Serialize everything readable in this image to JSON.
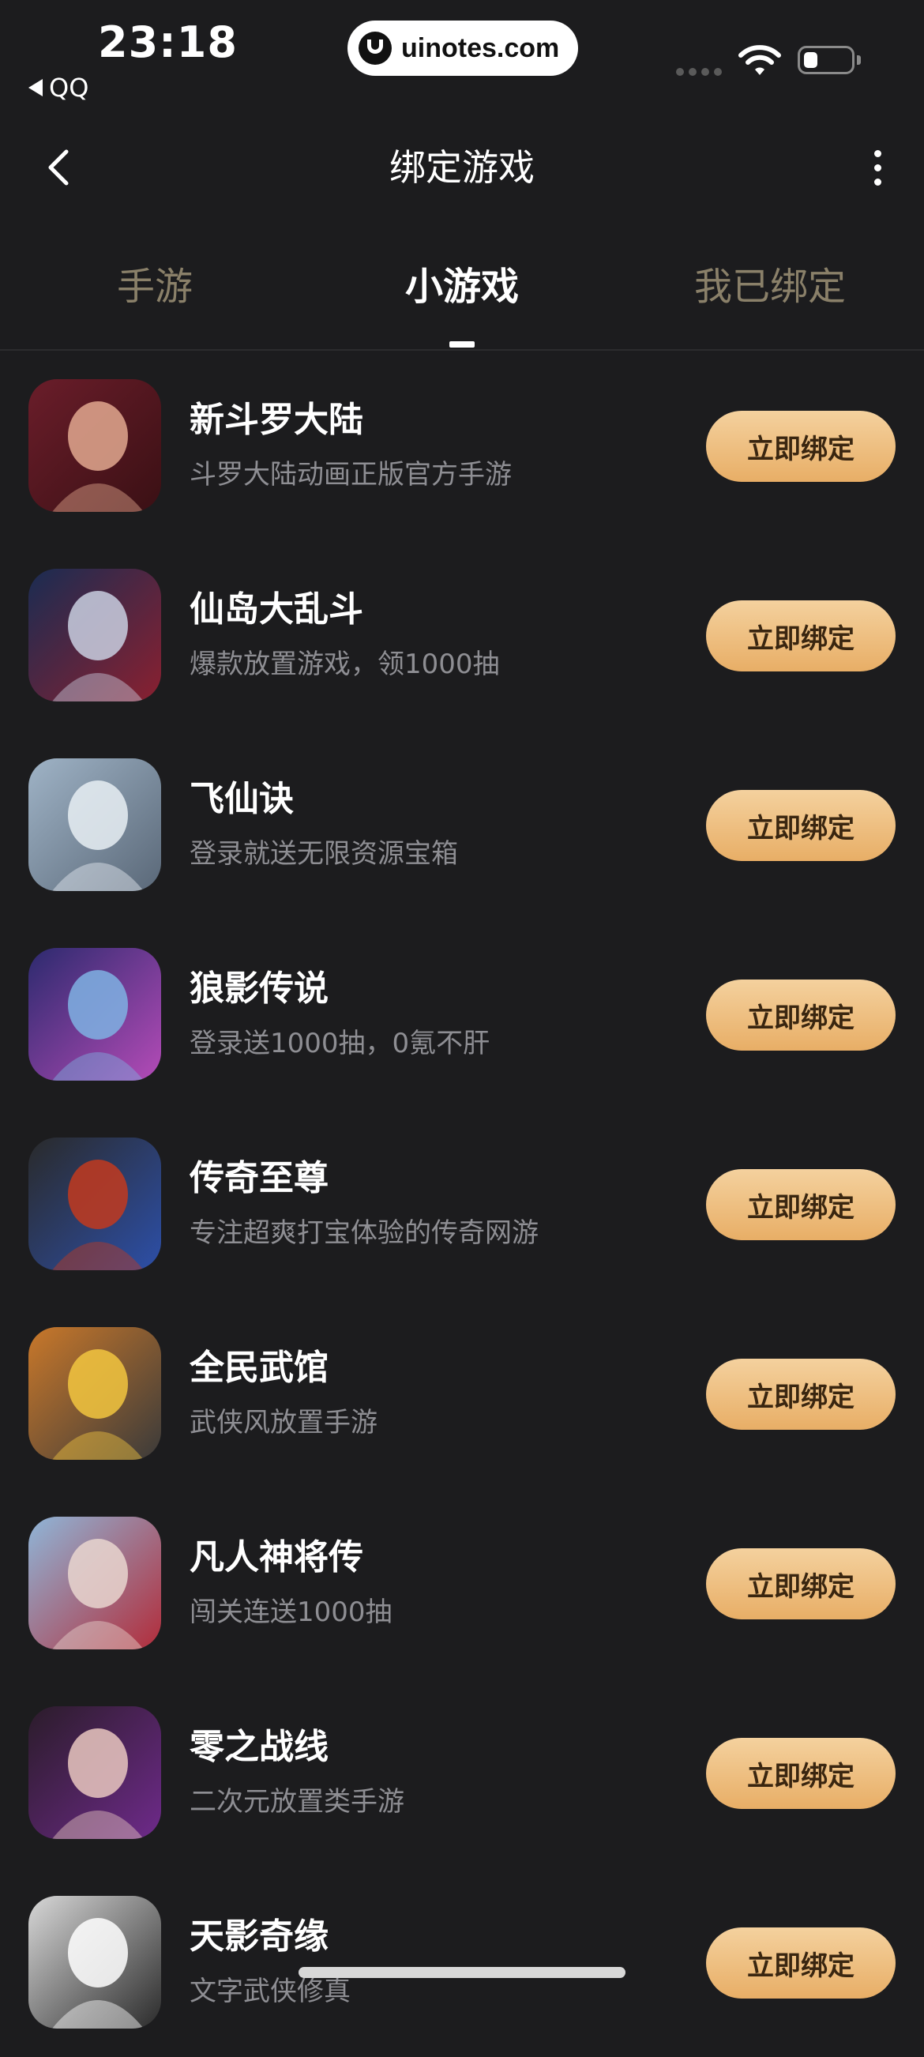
{
  "status_bar": {
    "time": "23:18",
    "back_app": "QQ",
    "url": "uinotes.com",
    "battery_level": 0.3
  },
  "nav": {
    "title": "绑定游戏"
  },
  "tabs": [
    {
      "label": "手游",
      "active": false
    },
    {
      "label": "小游戏",
      "active": true
    },
    {
      "label": "我已绑定",
      "active": false
    }
  ],
  "bind_label": "立即绑定",
  "games": [
    {
      "name": "新斗罗大陆",
      "desc": "斗罗大陆动画正版官方手游",
      "colors": [
        "#6a1d2a",
        "#e2a88f",
        "#3a1014"
      ]
    },
    {
      "name": "仙岛大乱斗",
      "desc": "爆款放置游戏，领1000抽",
      "colors": [
        "#1a2c52",
        "#c9cfe0",
        "#8a2030"
      ]
    },
    {
      "name": "飞仙诀",
      "desc": "登录就送无限资源宝箱",
      "colors": [
        "#9fb3c6",
        "#e8eef3",
        "#5a6878"
      ]
    },
    {
      "name": "狼影传说",
      "desc": "登录送1000抽，0氪不肝",
      "colors": [
        "#2c2a6e",
        "#7fb2e3",
        "#b44bb7"
      ]
    },
    {
      "name": "传奇至尊",
      "desc": "专注超爽打宝体验的传奇网游",
      "colors": [
        "#2a2a2a",
        "#c23a1e",
        "#2d4fa8"
      ]
    },
    {
      "name": "全民武馆",
      "desc": "武侠风放置手游",
      "colors": [
        "#c9782a",
        "#f2c640",
        "#3a3a3a"
      ]
    },
    {
      "name": "凡人神将传",
      "desc": "闯关连送1000抽",
      "colors": [
        "#8fb6d8",
        "#e9d6cf",
        "#b22c3a"
      ]
    },
    {
      "name": "零之战线",
      "desc": "二次元放置类手游",
      "colors": [
        "#2b1c2a",
        "#e9c7c0",
        "#6e2a8a"
      ]
    },
    {
      "name": "天影奇缘",
      "desc": "文字武侠修真",
      "colors": [
        "#d8d8d8",
        "#ffffff",
        "#2a2a2a"
      ]
    }
  ]
}
